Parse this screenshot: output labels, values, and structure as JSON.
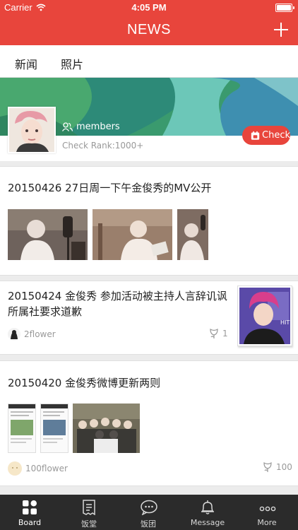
{
  "status_bar": {
    "carrier": "Carrier",
    "time": "4:05 PM",
    "battery_level": 1.0
  },
  "nav": {
    "title": "NEWS",
    "add_icon": "plus-icon"
  },
  "tabs": [
    {
      "label": "新闻",
      "active": true
    },
    {
      "label": "照片",
      "active": false
    }
  ],
  "profile": {
    "members_label": "members",
    "rank_label": "Check Rank:1000+",
    "check_button": "Check"
  },
  "feed": [
    {
      "title": "20150426 27日周一下午金俊秀的MV公开",
      "photos": 3
    },
    {
      "title": "20150424 金俊秀 参加活动被主持人言辞讥讽 所属社要求道歉",
      "author": "2flower",
      "likes": "1"
    },
    {
      "title": "20150420 金俊秀微博更新两则",
      "photos": 3,
      "author": "100flower",
      "likes": "100"
    }
  ],
  "tab_bar": [
    {
      "label": "Board",
      "icon": "grid-icon",
      "active": true
    },
    {
      "label": "饭堂",
      "icon": "document-icon",
      "active": false
    },
    {
      "label": "饭团",
      "icon": "chat-bubble-icon",
      "active": false
    },
    {
      "label": "Message",
      "icon": "bell-icon",
      "active": false
    },
    {
      "label": "More",
      "icon": "more-dots-icon",
      "active": false
    }
  ],
  "colors": {
    "accent": "#e8453c",
    "tab_bar_bg": "#2b2b2b",
    "page_bg": "#ececec"
  }
}
